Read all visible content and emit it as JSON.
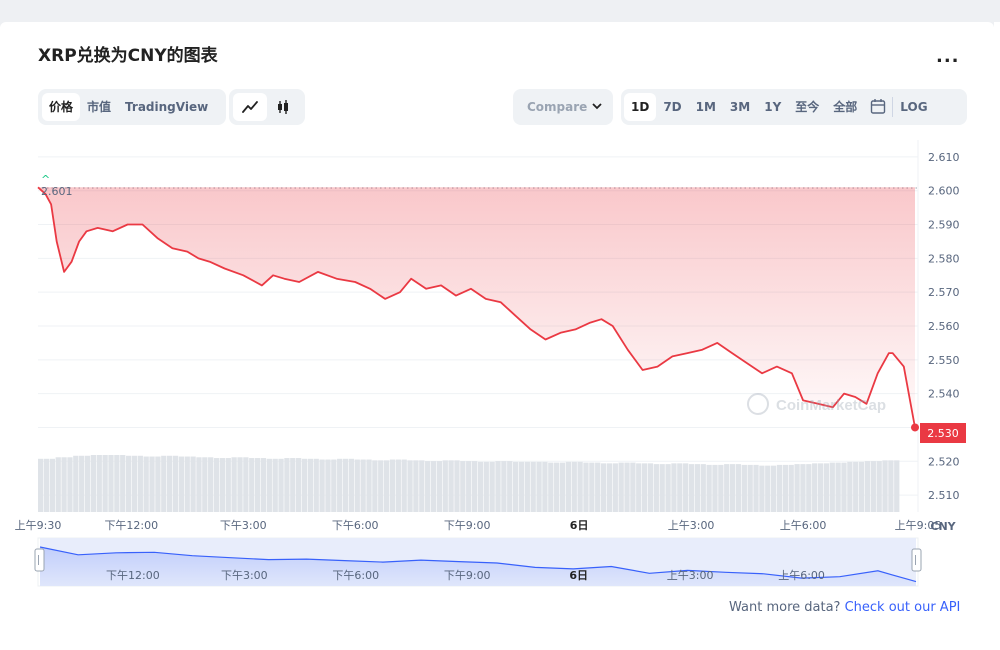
{
  "title": "XRP兑换为CNY的图表",
  "more_label": "...",
  "view_tabs": [
    {
      "label": "价格",
      "active": true
    },
    {
      "label": "市值",
      "active": false
    },
    {
      "label": "TradingView",
      "active": false
    }
  ],
  "chart_icons": [
    "line-chart-icon",
    "candlestick-icon"
  ],
  "compare_label": "Compare",
  "range_tabs": [
    {
      "label": "1D",
      "active": true
    },
    {
      "label": "7D",
      "active": false
    },
    {
      "label": "1M",
      "active": false
    },
    {
      "label": "3M",
      "active": false
    },
    {
      "label": "1Y",
      "active": false
    },
    {
      "label": "至今",
      "active": false
    },
    {
      "label": "全部",
      "active": false
    }
  ],
  "calendar_icon": "calendar-icon",
  "log_label": "LOG",
  "watermark": "CoinMarketCap",
  "footer": {
    "text": "Want more data?",
    "link": "Check out our API"
  },
  "colors": {
    "line": "#ea3943",
    "fill": "#fbd7d9",
    "volume": "#dfe3e8",
    "navigator": "#3861fb",
    "axis_text": "#58667e"
  },
  "chart_data": {
    "type": "area",
    "currency_label": "CNY",
    "open_value": "2.601",
    "last_value": "2.530",
    "ylim": [
      2.505,
      2.615
    ],
    "y_ticks": [
      "2.610",
      "2.600",
      "2.590",
      "2.580",
      "2.570",
      "2.560",
      "2.550",
      "2.540",
      "2.530",
      "2.520",
      "2.510"
    ],
    "x_ticks": [
      "上午9:30",
      "下午12:00",
      "下午3:00",
      "下午6:00",
      "下午9:00",
      "6日",
      "上午3:00",
      "上午6:00",
      "上午9:05"
    ],
    "navigator_ticks": [
      "下午12:00",
      "下午3:00",
      "下午6:00",
      "下午9:00",
      "6日",
      "上午3:00",
      "上午6:00"
    ],
    "x_hours": [
      0,
      0.2,
      0.35,
      0.5,
      0.7,
      0.9,
      1.1,
      1.3,
      1.6,
      2.0,
      2.4,
      2.8,
      3.2,
      3.6,
      4.0,
      4.3,
      4.6,
      5.0,
      5.5,
      6.0,
      6.3,
      6.6,
      7.0,
      7.5,
      8.0,
      8.5,
      8.9,
      9.3,
      9.7,
      10.0,
      10.4,
      10.8,
      11.2,
      11.6,
      12.0,
      12.4,
      12.8,
      13.2,
      13.6,
      14.0,
      14.4,
      14.8,
      15.1,
      15.4,
      15.8,
      16.2,
      16.6,
      17.0,
      17.4,
      17.8,
      18.2,
      18.6,
      19.0,
      19.4,
      19.8,
      20.2,
      20.5,
      20.9,
      21.3,
      21.6,
      21.9,
      22.2,
      22.5,
      22.8,
      22.9,
      23.2,
      23.5
    ],
    "values": [
      2.601,
      2.599,
      2.596,
      2.585,
      2.576,
      2.579,
      2.585,
      2.588,
      2.589,
      2.588,
      2.59,
      2.59,
      2.586,
      2.583,
      2.582,
      2.58,
      2.579,
      2.577,
      2.575,
      2.572,
      2.575,
      2.574,
      2.573,
      2.576,
      2.574,
      2.573,
      2.571,
      2.568,
      2.57,
      2.574,
      2.571,
      2.572,
      2.569,
      2.571,
      2.568,
      2.567,
      2.563,
      2.559,
      2.556,
      2.558,
      2.559,
      2.561,
      2.562,
      2.56,
      2.553,
      2.547,
      2.548,
      2.551,
      2.552,
      2.553,
      2.555,
      2.552,
      2.549,
      2.546,
      2.548,
      2.546,
      2.538,
      2.537,
      2.536,
      2.54,
      2.539,
      2.537,
      2.546,
      2.552,
      2.552,
      2.548,
      2.53
    ],
    "navigator_values": [
      2.601,
      2.585,
      2.589,
      2.59,
      2.583,
      2.579,
      2.575,
      2.576,
      2.573,
      2.57,
      2.574,
      2.571,
      2.568,
      2.559,
      2.556,
      2.561,
      2.547,
      2.553,
      2.549,
      2.546,
      2.537,
      2.54,
      2.552,
      2.53
    ],
    "volume_values": [
      0.7,
      0.72,
      0.74,
      0.75,
      0.75,
      0.74,
      0.73,
      0.74,
      0.73,
      0.72,
      0.71,
      0.72,
      0.71,
      0.7,
      0.71,
      0.7,
      0.69,
      0.7,
      0.69,
      0.68,
      0.69,
      0.68,
      0.67,
      0.68,
      0.67,
      0.66,
      0.67,
      0.66,
      0.66,
      0.65,
      0.66,
      0.65,
      0.64,
      0.65,
      0.64,
      0.63,
      0.64,
      0.63,
      0.62,
      0.63,
      0.62,
      0.61,
      0.62,
      0.63,
      0.64,
      0.65,
      0.66,
      0.67,
      0.68
    ]
  }
}
